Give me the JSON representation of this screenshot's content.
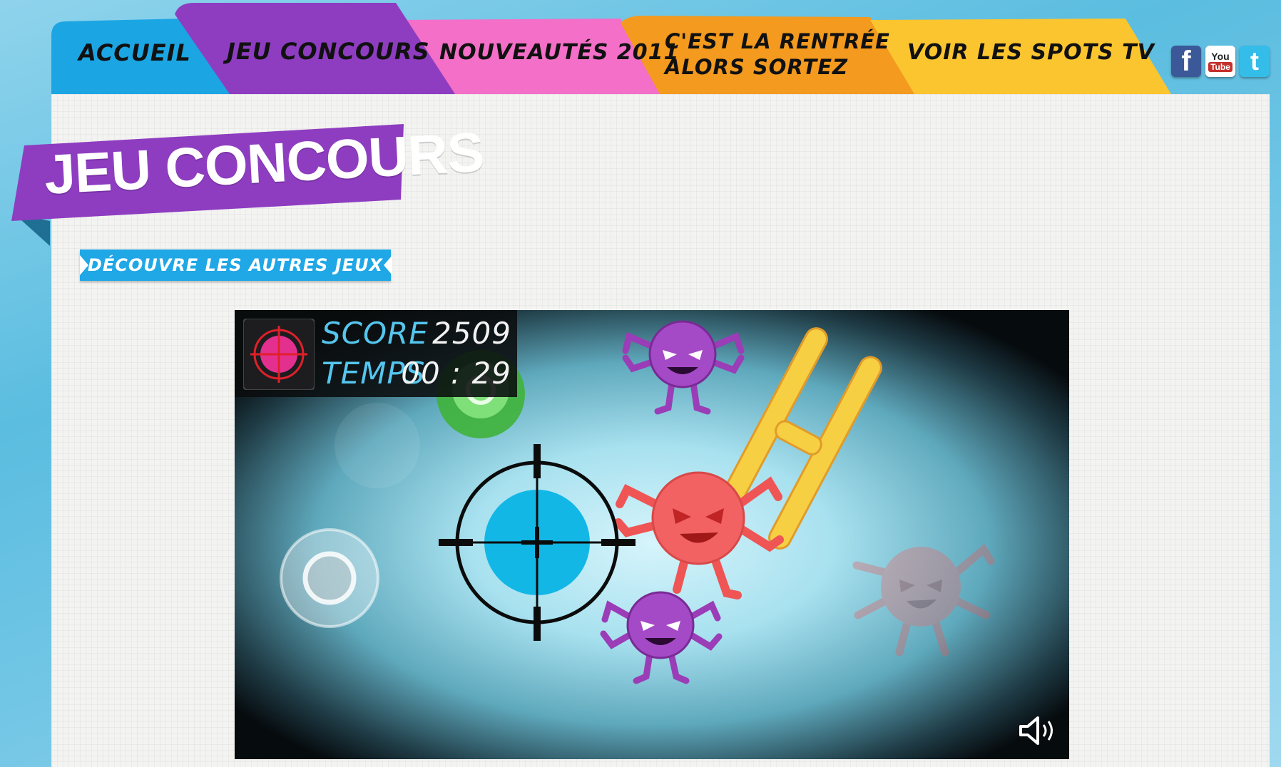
{
  "nav": {
    "tabs": [
      {
        "label": "ACCUEIL",
        "color": "#1ba6e3"
      },
      {
        "label": "JEU CONCOURS",
        "color": "#8e3dc1"
      },
      {
        "label": "NOUVEAUTÉS 2011",
        "color": "#f36fc8"
      },
      {
        "label_line1": "C'EST LA RENTRÉE",
        "label_line2": "ALORS SORTEZ",
        "color": "#f39a1f"
      },
      {
        "label": "VOIR LES SPOTS TV",
        "color": "#fbc52f"
      }
    ],
    "social": {
      "facebook": {
        "icon": "facebook-icon",
        "glyph": "f",
        "color": "#3b5998"
      },
      "youtube": {
        "icon": "youtube-icon",
        "line1": "You",
        "line2": "Tube",
        "color": "#c4302b"
      },
      "twitter": {
        "icon": "twitter-icon",
        "glyph": "t",
        "color": "#33bde8"
      }
    }
  },
  "page": {
    "title": "JEU CONCOURS",
    "title_color": "#8e3dc1",
    "other_games_button": "DÉCOUVRE LES AUTRES JEUX"
  },
  "game": {
    "hud": {
      "score_label": "SCORE",
      "score_value": "2509",
      "time_label": "TEMPS",
      "time_value": "00 : 29",
      "player_icon": "target-virus-icon"
    },
    "sound_icon": "speaker-icon"
  }
}
